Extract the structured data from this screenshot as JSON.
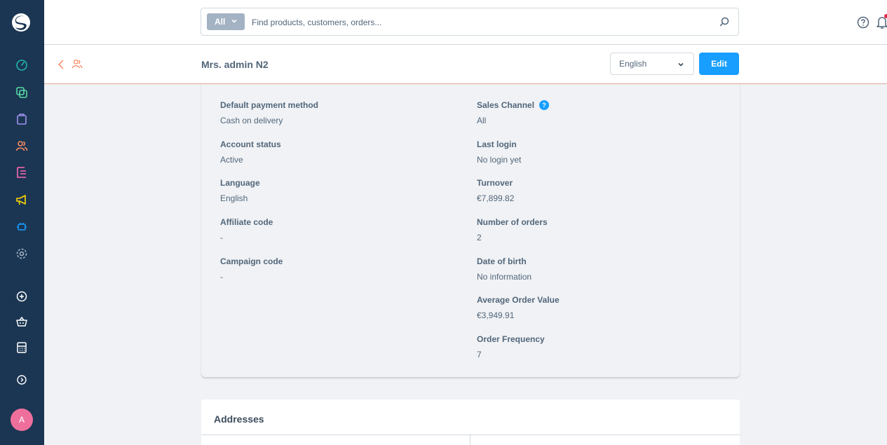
{
  "sidebar": {
    "logo": "shopware-logo",
    "items": [
      {
        "name": "dashboard-icon",
        "color": "#1fb3ab"
      },
      {
        "name": "catalogues-icon",
        "color": "#57d9a3"
      },
      {
        "name": "orders-icon",
        "color": "#a092f0"
      },
      {
        "name": "customers-icon",
        "color": "#f88962"
      },
      {
        "name": "content-icon",
        "color": "#ff68b4"
      },
      {
        "name": "marketing-icon",
        "color": "#ffd700"
      },
      {
        "name": "extensions-icon",
        "color": "#189eff"
      },
      {
        "name": "settings-icon",
        "color": "#a2b4c6"
      },
      {
        "name": "add-icon",
        "color": "#ffffff"
      },
      {
        "name": "basket-icon",
        "color": "#ffffff"
      },
      {
        "name": "calculator-icon",
        "color": "#ffffff"
      },
      {
        "name": "expand-icon",
        "color": "#ffffff"
      }
    ],
    "avatar_initial": "A"
  },
  "search": {
    "type_label": "All",
    "placeholder": "Find products, customers, orders..."
  },
  "smartbar": {
    "title": "Mrs. admin N2",
    "language": "English",
    "edit_label": "Edit"
  },
  "details": {
    "left": [
      {
        "label": "Default payment method",
        "value": "Cash on delivery"
      },
      {
        "label": "Account status",
        "value": "Active"
      },
      {
        "label": "Language",
        "value": "English"
      },
      {
        "label": "Affiliate code",
        "value": "-"
      },
      {
        "label": "Campaign code",
        "value": "-"
      }
    ],
    "right": [
      {
        "label": "Sales Channel",
        "value": "All",
        "help": "?"
      },
      {
        "label": "Last login",
        "value": "No login yet"
      },
      {
        "label": "Turnover",
        "value": "€7,899.82"
      },
      {
        "label": "Number of orders",
        "value": "2"
      },
      {
        "label": "Date of birth",
        "value": "No information"
      },
      {
        "label": "Average Order Value",
        "value": "€3,949.91"
      },
      {
        "label": "Order Frequency",
        "value": "7"
      }
    ]
  },
  "addresses": {
    "title": "Addresses"
  },
  "colors": {
    "sidebar": "#1b3653",
    "accent": "#189eff",
    "module": "#f88962"
  }
}
